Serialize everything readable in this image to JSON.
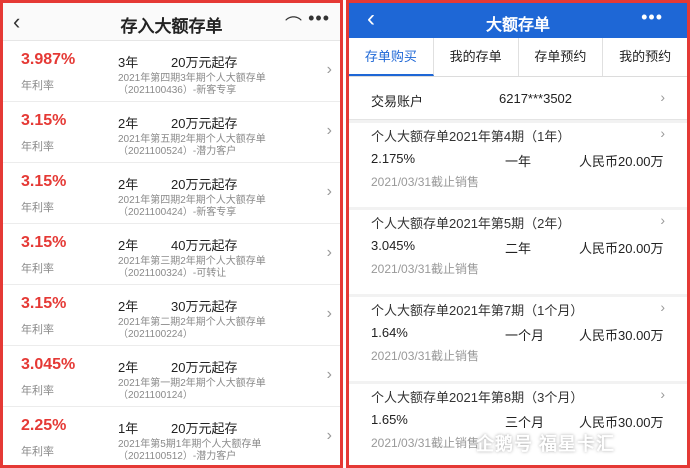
{
  "left": {
    "title": "存入大额存单",
    "rate_label": "年利率",
    "items": [
      {
        "rate": "3.987%",
        "term": "3年",
        "amount": "20万元起存",
        "desc1": "2021年第四期3年期个人大额存单",
        "desc2": "（2021100436）-新客专享"
      },
      {
        "rate": "3.15%",
        "term": "2年",
        "amount": "20万元起存",
        "desc1": "2021年第五期2年期个人大额存单",
        "desc2": "（2021100524）-潜力客户"
      },
      {
        "rate": "3.15%",
        "term": "2年",
        "amount": "20万元起存",
        "desc1": "2021年第四期2年期个人大额存单",
        "desc2": "（2021100424）-新客专享"
      },
      {
        "rate": "3.15%",
        "term": "2年",
        "amount": "40万元起存",
        "desc1": "2021年第三期2年期个人大额存单",
        "desc2": "（2021100324）-可转让"
      },
      {
        "rate": "3.15%",
        "term": "2年",
        "amount": "30万元起存",
        "desc1": "2021年第二期2年期个人大额存单",
        "desc2": "（2021100224）"
      },
      {
        "rate": "3.045%",
        "term": "2年",
        "amount": "20万元起存",
        "desc1": "2021年第一期2年期个人大额存单",
        "desc2": "（2021100124）"
      },
      {
        "rate": "2.25%",
        "term": "1年",
        "amount": "20万元起存",
        "desc1": "2021年第5期1年期个人大额存单",
        "desc2": "（2021100512）-潜力客户"
      }
    ]
  },
  "right": {
    "title": "大额存单",
    "tabs": [
      "存单购买",
      "我的存单",
      "存单预约",
      "我的预约"
    ],
    "account_label": "交易账户",
    "account_value": "6217***3502",
    "products": [
      {
        "name": "个人大额存单2021年第4期（1年）",
        "rate": "2.175%",
        "term": "一年",
        "amount": "人民币20.00万",
        "status": "2021/03/31截止销售"
      },
      {
        "name": "个人大额存单2021年第5期（2年）",
        "rate": "3.045%",
        "term": "二年",
        "amount": "人民币20.00万",
        "status": "2021/03/31截止销售"
      },
      {
        "name": "个人大额存单2021年第7期（1个月）",
        "rate": "1.64%",
        "term": "一个月",
        "amount": "人民币30.00万",
        "status": "2021/03/31截止销售"
      },
      {
        "name": "个人大额存单2021年第8期（3个月）",
        "rate": "1.65%",
        "term": "三个月",
        "amount": "人民币30.00万",
        "status": "2021/03/31截止销售"
      }
    ]
  },
  "watermark": "企鹅号 福星卡汇",
  "colors": {
    "accent_red": "#e53935",
    "brand_blue": "#1e67d6"
  }
}
